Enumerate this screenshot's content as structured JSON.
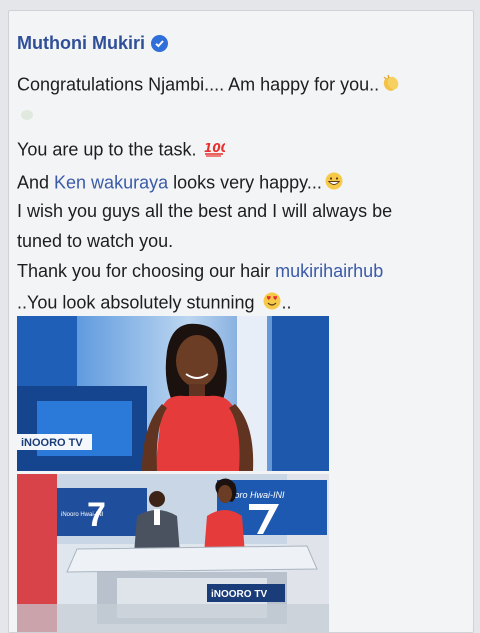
{
  "post": {
    "author_name": "Muthoni Mukiri",
    "line1": "Congratulations Njambi.... Am happy for you..",
    "line2": "You are up to the task.",
    "line3_prefix": "And ",
    "line3_mention": "Ken wakuraya",
    "line3_suffix": " looks very happy...",
    "line4": "I wish you guys all the best and I will always be",
    "line5": "tuned to watch you.",
    "line6_prefix": "Thank you for choosing our hair ",
    "line6_mention": "mukirihairhub",
    "line7_prefix": "..You look absolutely stunning ",
    "line7_suffix": "..",
    "hundred_emoji_text": "100"
  },
  "images": {
    "photo1_logo": "iNOORO TV",
    "photo2_logo": "iNOORO TV",
    "photo2_sign_right": "iNooro Hwai-INI",
    "photo2_sign_left": "7",
    "photo2_sign_left_small": "iNooro Hwai-INI"
  },
  "colors": {
    "author": "#2f4f99",
    "mention": "#3b5ba8",
    "verified": "#2e6fd9",
    "studio_blue": "#1f5fb8",
    "dress_red": "#e53b3b"
  },
  "icons": {
    "verified": "verified-badge-icon",
    "clap": "clapping-hands-emoji",
    "hundred": "hundred-points-emoji",
    "grin": "grinning-face-emoji",
    "heart_eyes": "heart-eyes-emoji"
  }
}
